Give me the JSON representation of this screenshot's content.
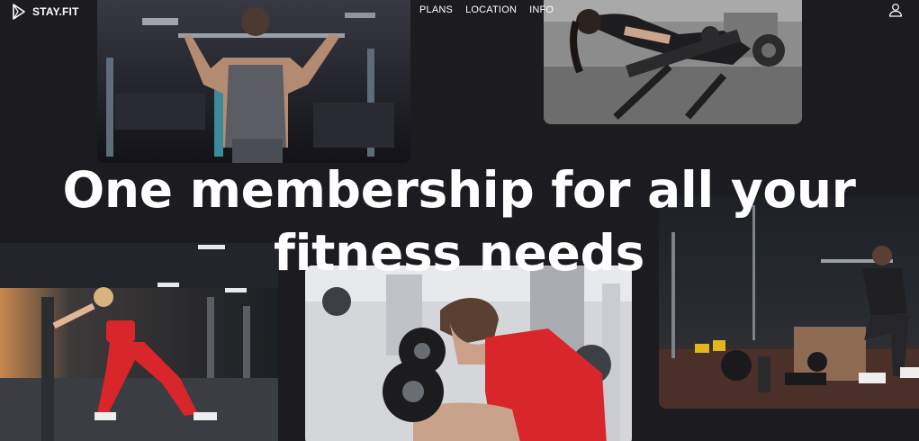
{
  "brand": {
    "logo_text": "STAY.FIT",
    "icon": "play-triangle-icon"
  },
  "nav": {
    "links": [
      "PLANS",
      "LOCATION",
      "INFO"
    ]
  },
  "account": {
    "icon": "user-icon"
  },
  "hero": {
    "headline": "One membership for all your fitness needs"
  },
  "photos": [
    {
      "subject": "man-lat-pulldown"
    },
    {
      "subject": "woman-bench-exercise"
    },
    {
      "subject": "woman-cable-lunge"
    },
    {
      "subject": "man-dumbbell-curl"
    },
    {
      "subject": "man-resting-with-kettlebells"
    }
  ],
  "colors": {
    "background": "#1c1b1f",
    "text": "#ffffff",
    "accent_red": "#d8262b"
  }
}
